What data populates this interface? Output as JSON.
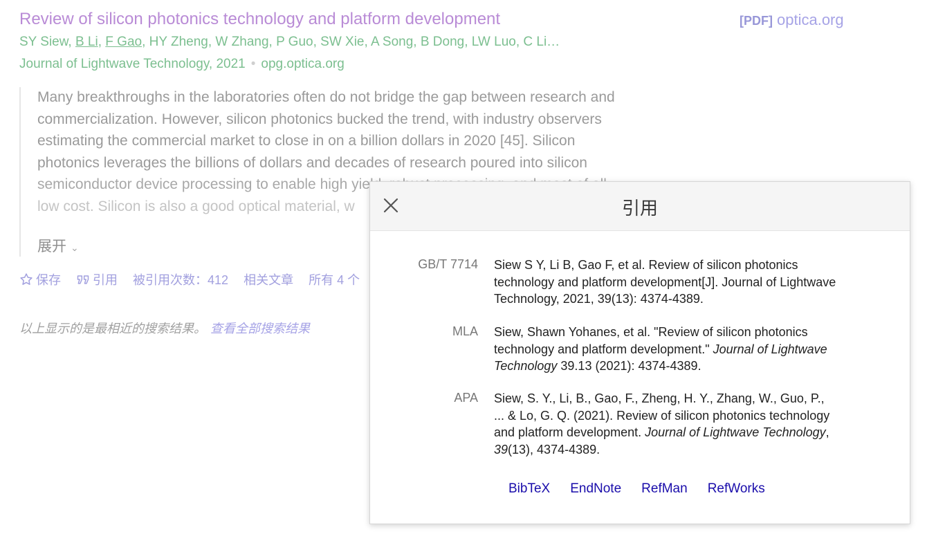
{
  "result": {
    "title": "Review of silicon photonics technology and platform development",
    "pdf_tag": "[PDF]",
    "pdf_domain": "optica.org",
    "authors": {
      "a1": "SY Siew, ",
      "a2": "B Li",
      "sep1": ", ",
      "a3": "F Gao",
      "rest": ", HY Zheng, W Zhang, P Guo, SW Xie, A Song, B Dong, LW Luo, C Li…"
    },
    "venue": "Journal of Lightwave Technology, 2021",
    "venue_separator": "•",
    "source": "opg.optica.org",
    "snippet": [
      "Many breakthroughs in the laboratories often do not bridge the gap between research and",
      "commercialization. However, silicon photonics bucked the trend, with industry observers",
      "estimating the commercial market to close in on a billion dollars in 2020 [45]. Silicon",
      "photonics leverages the billions of dollars and decades of research poured into silicon",
      "semiconductor device processing to enable high yield, robust processing, and most of all,",
      "low cost. Silicon is also a good optical material, w"
    ],
    "expand_label": "展开",
    "actions": {
      "save": "保存",
      "cite": "引用",
      "cited_by": "被引用次数：412",
      "related": "相关文章",
      "all_versions": "所有 4 个"
    }
  },
  "footer_note": {
    "text": "以上显示的是最相近的搜索结果。",
    "link": "查看全部搜索结果"
  },
  "cite_dialog": {
    "title": "引用",
    "citations": [
      {
        "style": "GB/T 7714",
        "line1": "Siew S Y, Li B, Gao F, et al. Review of silicon photonics",
        "line2": "technology and platform development[J]. Journal of Lightwave",
        "line3": "Technology, 2021, 39(13): 4374-4389."
      },
      {
        "style": "MLA",
        "line1": "Siew, Shawn Yohanes, et al. \"Review of silicon photonics",
        "line2a": "technology and platform development.\" ",
        "line2b": "Journal of Lightwave",
        "line3a": "Technology",
        "line3b": " 39.13 (2021): 4374-4389."
      },
      {
        "style": "APA",
        "line1": "Siew, S. Y., Li, B., Gao, F., Zheng, H. Y., Zhang, W., Guo, P.,",
        "line2": "... & Lo, G. Q. (2021). Review of silicon photonics technology",
        "line3a": "and platform development. ",
        "line3b": "Journal of Lightwave Technology",
        "line3c": ",",
        "line4a": "39",
        "line4b": "(13), 4374-4389."
      }
    ],
    "exports": [
      "BibTeX",
      "EndNote",
      "RefMan",
      "RefWorks"
    ]
  },
  "colors": {
    "title_purple": "#b98bd6",
    "green": "#7cbf90",
    "link_blue": "#1a0dab",
    "action_purple": "#a2a0df"
  }
}
